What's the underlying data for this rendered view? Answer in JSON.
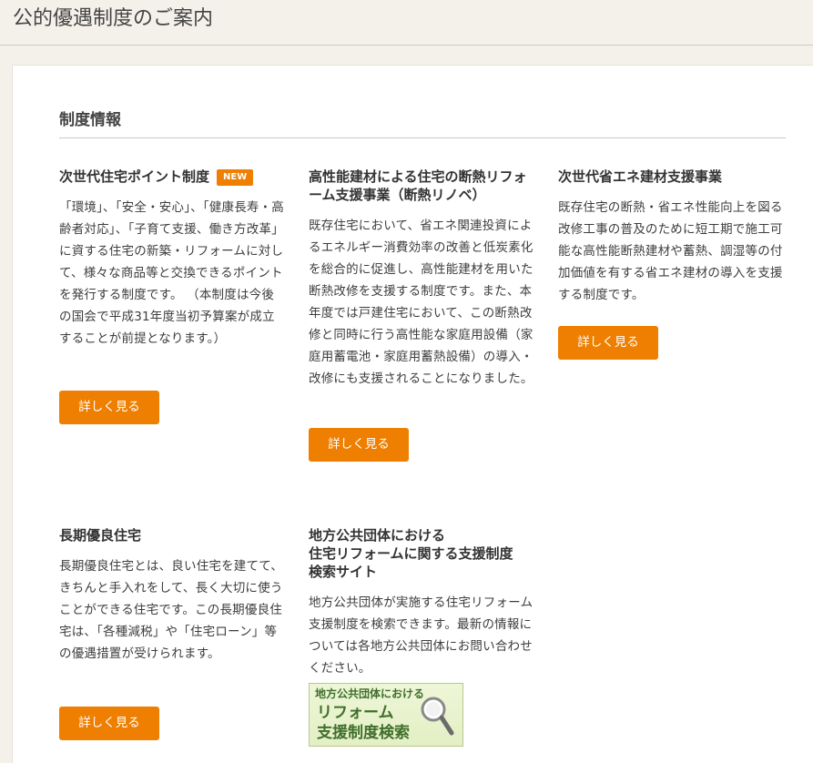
{
  "page": {
    "title": "公的優遇制度のご案内"
  },
  "section": {
    "heading": "制度情報"
  },
  "cards": [
    {
      "title": "次世代住宅ポイント制度",
      "badge": "NEW",
      "body": "「環境」、「安全・安心」、「健康長寿・高齢者対応」、「子育て支援、働き方改革」に資する住宅の新築・リフォームに対して、様々な商品等と交換できるポイントを発行する制度です。 （本制度は今後の国会で平成31年度当初予算案が成立することが前提となります。）",
      "button": "詳しく見る"
    },
    {
      "title": "高性能建材による住宅の断熱リフォーム支援事業（断熱リノベ）",
      "body": "既存住宅において、省エネ関連投資によるエネルギー消費効率の改善と低炭素化を総合的に促進し、高性能建材を用いた断熱改修を支援する制度です。また、本年度では戸建住宅において、この断熱改修と同時に行う高性能な家庭用設備（家庭用蓄電池・家庭用蓄熱設備）の導入・改修にも支援されることになりました。",
      "button": "詳しく見る"
    },
    {
      "title": "次世代省エネ建材支援事業",
      "body": "既存住宅の断熱・省エネ性能向上を図る改修工事の普及のために短工期で施工可能な高性能断熱建材や蓄熱、調湿等の付加価値を有する省エネ建材の導入を支援する制度です。",
      "button": "詳しく見る"
    },
    {
      "title": "長期優良住宅",
      "body": "長期優良住宅とは、良い住宅を建てて、きちんと手入れをして、長く大切に使うことができる住宅です。この長期優良住宅は、「各種減税」や「住宅ローン」等の優遇措置が受けられます。",
      "button": "詳しく見る"
    },
    {
      "title_lines": [
        "地方公共団体における",
        "住宅リフォームに関する支援制度",
        "検索サイト"
      ],
      "body": "地方公共団体が実施する住宅リフォーム支援制度を検索できます。最新の情報については各地方公共団体にお問い合わせください。",
      "banner": {
        "line1": "地方公共団体における",
        "line2": "リフォーム",
        "line3": "支援制度検索",
        "icon": "magnifier-icon"
      }
    }
  ],
  "colors": {
    "accent": "#ee7f00",
    "background": "#f4f1ea",
    "panel": "#ffffff",
    "banner_text": "#3f6f2b"
  }
}
